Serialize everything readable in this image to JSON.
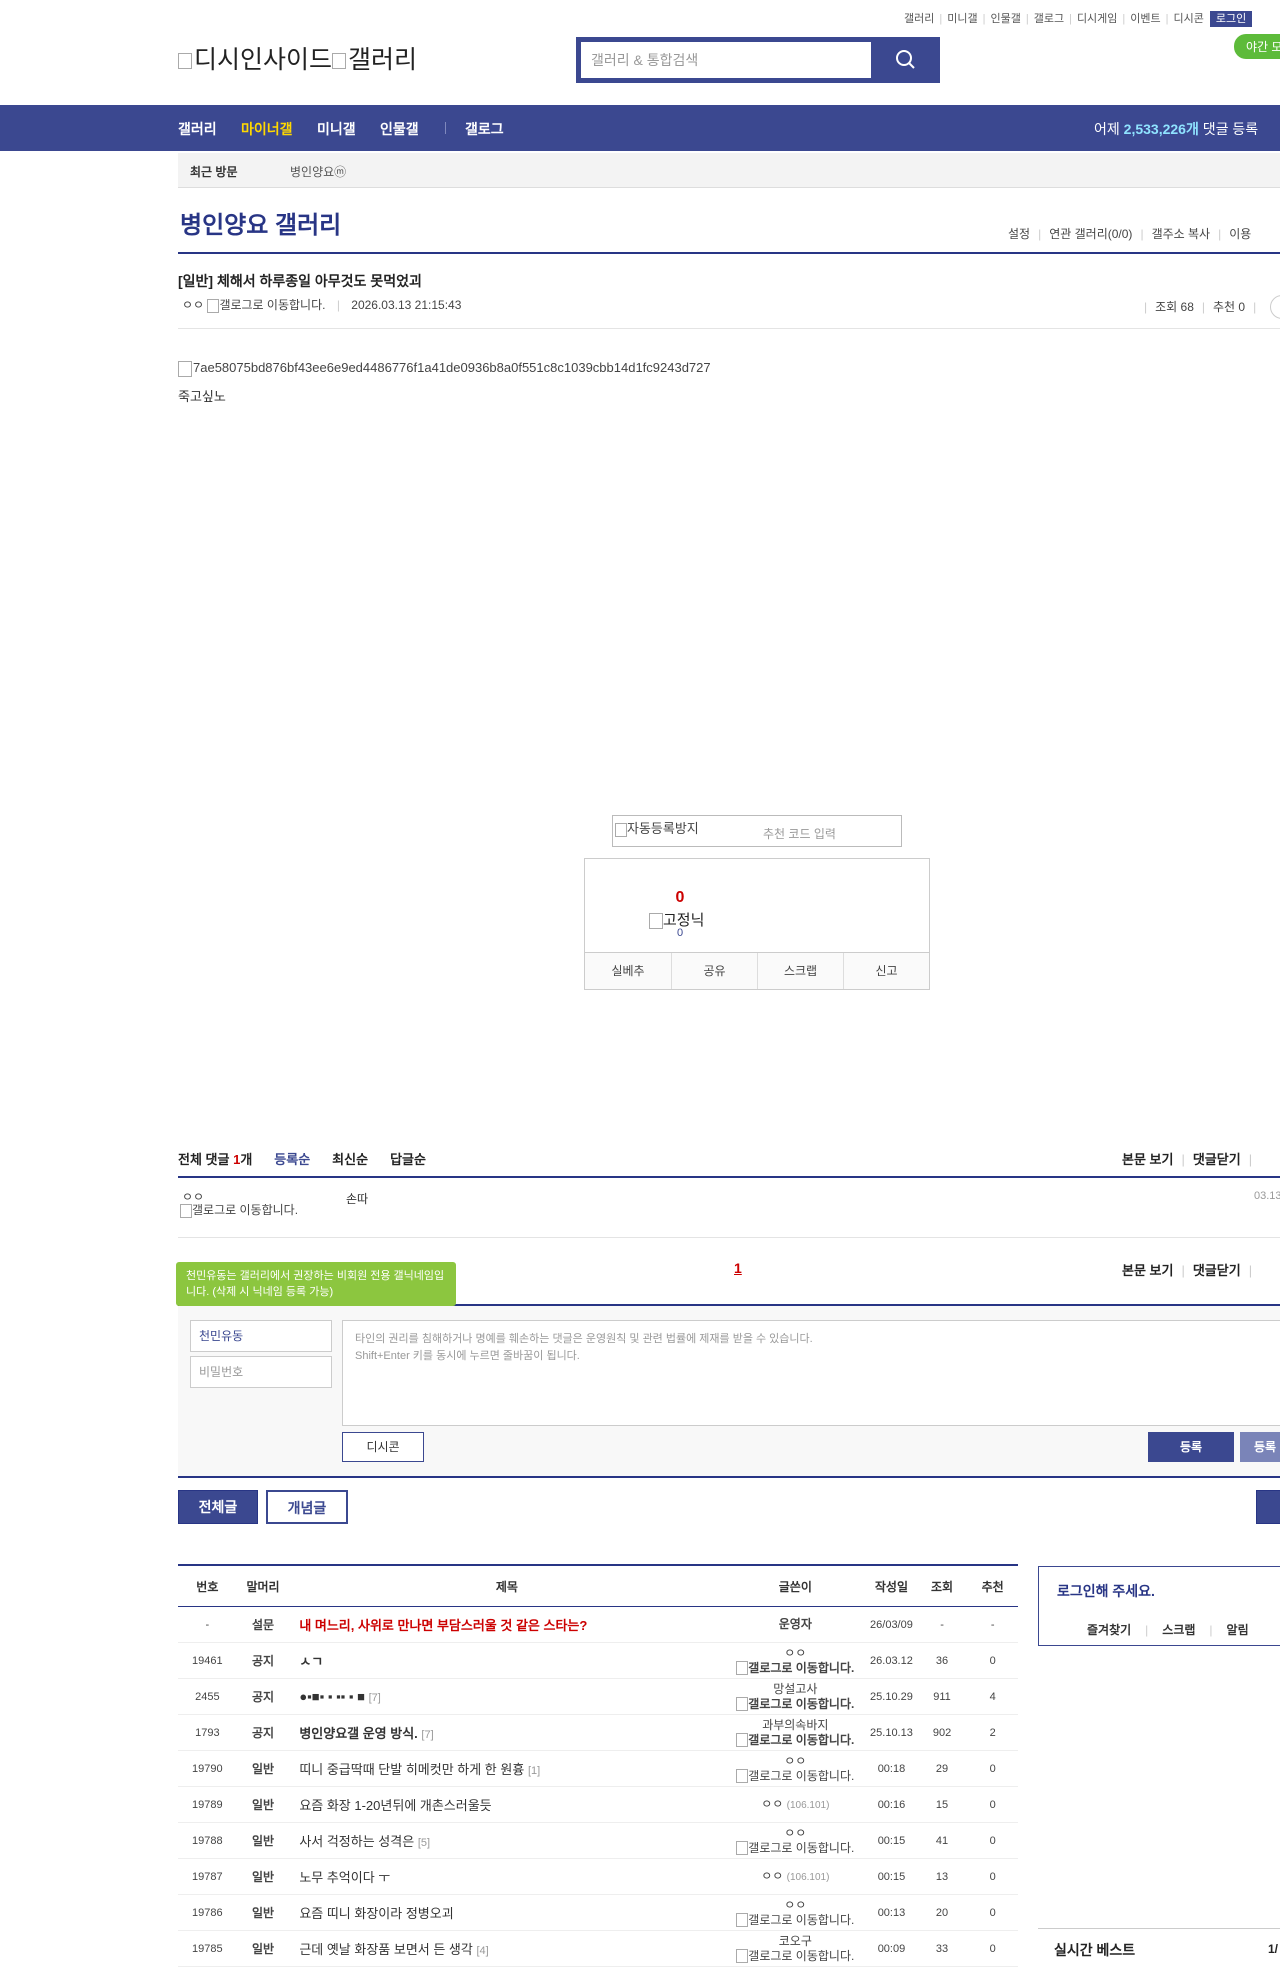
{
  "top_menu": [
    "갤러리",
    "미니갤",
    "인물갤",
    "갤로그",
    "디시게임",
    "이벤트",
    "디시콘"
  ],
  "login_label": "로그인",
  "night_mode_label": "야간 모",
  "logo": {
    "left_alt": "디시인사이드",
    "right_alt": "갤러리"
  },
  "search": {
    "placeholder": "갤러리 & 통합검색"
  },
  "gnb": {
    "items": [
      "갤러리",
      "마이너갤",
      "미니갤",
      "인물갤",
      "갤로그"
    ],
    "stat_prefix": "어제",
    "stat_value": "2,533,226개",
    "stat_suffix": "댓글 등록"
  },
  "recent_visit": {
    "label": "최근 방문",
    "item": "병인양요ⓜ"
  },
  "gallery": {
    "title": "병인양요 갤러리",
    "options": [
      "설정",
      "연관 갤러리(0/0)",
      "갤주소 복사",
      "이용"
    ]
  },
  "post": {
    "title": "[일반] 체해서 하루종일 아무것도 못먹었괴",
    "author": "ㅇㅇ",
    "author_icon_alt": "갤로그로 이동합니다.",
    "date": "2026.03.13 21:15:43",
    "views_label": "조회 68",
    "recommend_label": "추천 0",
    "image_alt": "7ae58075bd876bf43ee6e9ed4486776f1a41de0936b8a0f551c8c1039cbb14d1fc9243d727",
    "body_text": "죽고싶노"
  },
  "captcha": {
    "image_alt": "자동등록방지",
    "placeholder": "추천 코드 입력"
  },
  "recommend": {
    "count": "0",
    "fixed_nick_alt": "고정닉",
    "fixed_count": "0",
    "buttons": [
      "실베추",
      "공유",
      "스크랩",
      "신고"
    ]
  },
  "comments": {
    "total_label": "전체 댓글",
    "total_count": "1",
    "total_unit": "개",
    "sort": [
      "등록순",
      "최신순",
      "답글순"
    ],
    "right_links": [
      "본문 보기",
      "댓글닫기"
    ],
    "list": [
      {
        "name": "ㅇㅇ",
        "icon_alt": "갤로그로 이동합니다.",
        "text": "손따",
        "date": "03.13"
      }
    ],
    "page": "1"
  },
  "write": {
    "tooltip": "천민유동는 갤러리에서 권장하는 비회원 전용 갤닉네임입니다. (삭제 시 닉네임 등록 가능)",
    "nickname_value": "천민유동",
    "password_placeholder": "비밀번호",
    "textarea_line1": "타인의 권리를 침해하거나 명예를 훼손하는 댓글은 운영원칙 및 관련 법률에 제재를 받을 수 있습니다.",
    "textarea_line2": "Shift+Enter 키를 동시에 누르면 줄바꿈이 됩니다.",
    "dccon_label": "디시콘",
    "submit_label": "등록",
    "submit2_label": "등록"
  },
  "list_tabs": {
    "all": "전체글",
    "best": "개념글"
  },
  "table": {
    "headers": [
      "번호",
      "말머리",
      "제목",
      "글쓴이",
      "작성일",
      "조회",
      "추천"
    ],
    "rows": [
      {
        "no": "-",
        "head": "설문",
        "title": "내 며느리, 사위로 만나면 부담스러울 것 같은 스타는?",
        "reply": "",
        "writer": "운영자",
        "writer_icon": "",
        "ip": "",
        "date": "26/03/09",
        "views": "-",
        "rec": "-",
        "style": "red"
      },
      {
        "no": "19461",
        "head": "공지",
        "title": "ㅅㄱ",
        "reply": "",
        "writer": "ㅇㅇ",
        "writer_icon": "갤로그로 이동합니다.",
        "ip": "",
        "date": "26.03.12",
        "views": "36",
        "rec": "0",
        "style": "bold"
      },
      {
        "no": "2455",
        "head": "공지",
        "title": "●▪■▪ ▪ ▪▪ ▪ ■",
        "reply": "[7]",
        "writer": "망설고사",
        "writer_icon": "갤로그로 이동합니다.",
        "ip": "",
        "date": "25.10.29",
        "views": "911",
        "rec": "4",
        "style": "bold"
      },
      {
        "no": "1793",
        "head": "공지",
        "title": "병인양요갤 운영 방식.",
        "reply": "[7]",
        "writer": "과부의속바지",
        "writer_icon": "갤로그로 이동합니다.",
        "ip": "",
        "date": "25.10.13",
        "views": "902",
        "rec": "2",
        "style": "bold"
      },
      {
        "no": "19790",
        "head": "일반",
        "title": "띠니 중급딱때 단발 히메컷만 하게 한 원흉",
        "reply": "[1]",
        "writer": "ㅇㅇ",
        "writer_icon": "갤로그로 이동합니다.",
        "ip": "",
        "date": "00:18",
        "views": "29",
        "rec": "0",
        "style": ""
      },
      {
        "no": "19789",
        "head": "일반",
        "title": "요즘 화장 1-20년뒤에 개촌스러울듯",
        "reply": "",
        "writer": "ㅇㅇ",
        "writer_icon": "",
        "ip": "(106.101)",
        "date": "00:16",
        "views": "15",
        "rec": "0",
        "style": ""
      },
      {
        "no": "19788",
        "head": "일반",
        "title": "사서 걱정하는 성격은",
        "reply": "[5]",
        "writer": "ㅇㅇ",
        "writer_icon": "갤로그로 이동합니다.",
        "ip": "",
        "date": "00:15",
        "views": "41",
        "rec": "0",
        "style": ""
      },
      {
        "no": "19787",
        "head": "일반",
        "title": "노무 추억이다 ㅜ",
        "reply": "",
        "writer": "ㅇㅇ",
        "writer_icon": "",
        "ip": "(106.101)",
        "date": "00:15",
        "views": "13",
        "rec": "0",
        "style": ""
      },
      {
        "no": "19786",
        "head": "일반",
        "title": "요즘 띠니 화장이라 정병오괴",
        "reply": "",
        "writer": "ㅇㅇ",
        "writer_icon": "갤로그로 이동합니다.",
        "ip": "",
        "date": "00:13",
        "views": "20",
        "rec": "0",
        "style": ""
      },
      {
        "no": "19785",
        "head": "일반",
        "title": "근데 옛날 화장품 보면서 든 생각",
        "reply": "[4]",
        "writer": "코오구",
        "writer_icon": "갤로그로 이동합니다.",
        "ip": "",
        "date": "00:09",
        "views": "33",
        "rec": "0",
        "style": ""
      }
    ]
  },
  "sidebar": {
    "login_prompt": "로그인해 주세요.",
    "links": [
      "즐겨찾기",
      "스크랩",
      "알림"
    ],
    "best_title": "실시간 베스트",
    "best_page": "1/"
  },
  "colors": {
    "navy": "#3b4890",
    "accent_yellow": "#ffd800",
    "stat_blue": "#8fe3ff",
    "red": "#cc0000",
    "green": "#8cc63f"
  }
}
